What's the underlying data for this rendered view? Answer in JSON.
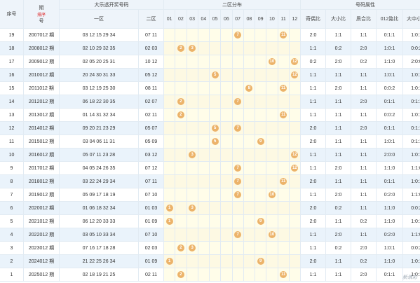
{
  "headers": {
    "seq": "序号",
    "issue_top": "期",
    "issue_bottom": "号",
    "issue_sort": "排序",
    "lotto_title": "大乐透开奖号码",
    "zone1": "一区",
    "zone2": "二区",
    "dist_title": "二区分布",
    "attr_title": "号码属性",
    "nums": [
      "01",
      "02",
      "03",
      "04",
      "05",
      "06",
      "07",
      "08",
      "09",
      "10",
      "11",
      "12"
    ],
    "attrs": [
      "奇偶比",
      "大小比",
      "质合比",
      "012路比",
      "大中小比"
    ]
  },
  "rows": [
    {
      "seq": "19",
      "issue": "2007012 期",
      "front": "03 12 15 29 34",
      "back": "07 11",
      "balls": [
        7,
        11
      ],
      "attrs": [
        "2:0",
        "1:1",
        "1:1",
        "0:1:1",
        "1:0:1"
      ]
    },
    {
      "seq": "18",
      "issue": "2008012 期",
      "front": "02 10 29 32 35",
      "back": "02 03",
      "balls": [
        2,
        3
      ],
      "attrs": [
        "1:1",
        "0:2",
        "2:0",
        "1:0:1",
        "0:0:2"
      ]
    },
    {
      "seq": "17",
      "issue": "2009012 期",
      "front": "02 05 20 25 31",
      "back": "10 12",
      "balls": [
        10,
        12
      ],
      "attrs": [
        "0:2",
        "2:0",
        "0:2",
        "1:1:0",
        "2:0:0"
      ]
    },
    {
      "seq": "16",
      "issue": "2010012 期",
      "front": "20 24 30 31 33",
      "back": "05 12",
      "balls": [
        5,
        12
      ],
      "attrs": [
        "1:1",
        "1:1",
        "1:1",
        "1:0:1",
        "1:0:1"
      ]
    },
    {
      "seq": "15",
      "issue": "2011012 期",
      "front": "03 12 19 25 30",
      "back": "08 11",
      "balls": [
        8,
        11
      ],
      "attrs": [
        "1:1",
        "2:0",
        "1:1",
        "0:0:2",
        "1:0:1"
      ]
    },
    {
      "seq": "14",
      "issue": "2012012 期",
      "front": "06 18 22 30 35",
      "back": "02 07",
      "balls": [
        2,
        7
      ],
      "attrs": [
        "1:1",
        "1:1",
        "2:0",
        "0:1:1",
        "0:1:1"
      ]
    },
    {
      "seq": "13",
      "issue": "2013012 期",
      "front": "01 14 31 32 34",
      "back": "02 11",
      "balls": [
        2,
        11
      ],
      "attrs": [
        "1:1",
        "1:1",
        "1:1",
        "0:0:2",
        "1:0:1"
      ]
    },
    {
      "seq": "12",
      "issue": "2014012 期",
      "front": "09 20 21 23 29",
      "back": "05 07",
      "balls": [
        5,
        7
      ],
      "attrs": [
        "2:0",
        "1:1",
        "2:0",
        "0:1:1",
        "0:1:1"
      ]
    },
    {
      "seq": "11",
      "issue": "2015012 期",
      "front": "03 04 06 11 31",
      "back": "05 09",
      "balls": [
        5,
        9
      ],
      "attrs": [
        "2:0",
        "1:1",
        "1:1",
        "1:0:1",
        "0:1:1"
      ]
    },
    {
      "seq": "10",
      "issue": "2016012 期",
      "front": "05 07 11 23 28",
      "back": "03 12",
      "balls": [
        3,
        12
      ],
      "attrs": [
        "1:1",
        "1:1",
        "1:1",
        "2:0:0",
        "1:0:1"
      ]
    },
    {
      "seq": "9",
      "issue": "2017012 期",
      "front": "04 05 24 26 35",
      "back": "07 12",
      "balls": [
        7,
        12
      ],
      "attrs": [
        "1:1",
        "2:0",
        "1:1",
        "1:1:0",
        "1:1:0"
      ]
    },
    {
      "seq": "8",
      "issue": "2018012 期",
      "front": "03 22 24 29 34",
      "back": "07 11",
      "balls": [
        7,
        11
      ],
      "attrs": [
        "2:0",
        "1:1",
        "1:1",
        "0:1:1",
        "1:0:1"
      ]
    },
    {
      "seq": "7",
      "issue": "2019012 期",
      "front": "05 09 17 18 19",
      "back": "07 10",
      "balls": [
        7,
        10
      ],
      "attrs": [
        "1:1",
        "2:0",
        "1:1",
        "0:2:0",
        "1:1:0"
      ]
    },
    {
      "seq": "6",
      "issue": "2020012 期",
      "front": "01 06 18 32 34",
      "back": "01 03",
      "balls": [
        1,
        3
      ],
      "attrs": [
        "2:0",
        "0:2",
        "1:1",
        "1:1:0",
        "0:0:2"
      ]
    },
    {
      "seq": "5",
      "issue": "2021012 期",
      "front": "06 12 20 33 33",
      "back": "01 09",
      "balls": [
        1,
        9
      ],
      "attrs": [
        "2:0",
        "1:1",
        "0:2",
        "1:1:0",
        "1:0:1"
      ]
    },
    {
      "seq": "4",
      "issue": "2022012 期",
      "front": "03 05 10 33 34",
      "back": "07 10",
      "balls": [
        7,
        10
      ],
      "attrs": [
        "1:1",
        "2:0",
        "1:1",
        "0:2:0",
        "1:1:0"
      ]
    },
    {
      "seq": "3",
      "issue": "2023012 期",
      "front": "07 16 17 18 28",
      "back": "02 03",
      "balls": [
        2,
        3
      ],
      "attrs": [
        "1:1",
        "0:2",
        "2:0",
        "1:0:1",
        "0:0:2"
      ]
    },
    {
      "seq": "2",
      "issue": "2024012 期",
      "front": "21 22 25 26 34",
      "back": "01 09",
      "balls": [
        1,
        9
      ],
      "attrs": [
        "2:0",
        "1:1",
        "0:2",
        "1:1:0",
        "1:0:1"
      ]
    },
    {
      "seq": "1",
      "issue": "2025012 期",
      "front": "02 18 19 21 25",
      "back": "02 11",
      "balls": [
        2,
        11
      ],
      "attrs": [
        "1:1",
        "1:1",
        "2:0",
        "0:1:1",
        "1:0:1"
      ]
    }
  ],
  "watermark": "新浪彩"
}
